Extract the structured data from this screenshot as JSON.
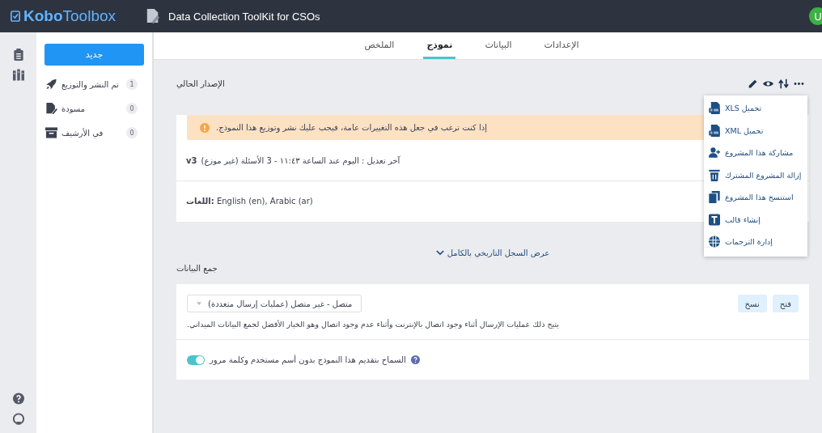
{
  "header": {
    "logo": "**Kobo**Toolbox",
    "project_title": "Data Collection ToolKit for CSOs",
    "avatar": "U"
  },
  "sidebar": {
    "new_button": "جديد",
    "items": [
      {
        "kind": "deployed",
        "label": "تم النشر والتوزيع",
        "count": "1"
      },
      {
        "kind": "draft",
        "label": "مسودة",
        "count": "0"
      },
      {
        "kind": "archived",
        "label": "في الأرشيف",
        "count": "0"
      }
    ]
  },
  "tabs": [
    {
      "label": "الإعدادات",
      "selected": false
    },
    {
      "label": "البيانات",
      "selected": false
    },
    {
      "label": "نموذج",
      "selected": true
    },
    {
      "label": "الملخص",
      "selected": false
    }
  ],
  "current_version": {
    "heading": "الإصدار الحالي",
    "alert": "إذا كنت ترغب في جعل هذه التغييرات عامة، فيجب عليك نشر وتوزيع هذا النموذج.",
    "version": "v3",
    "modified": "آخر تعديل : اليوم عند الساعة ١١:٤٣ - 3 الأسئلة  (غير موزع)",
    "languages": "**اللغات:** English (en), Arabic (ar)"
  },
  "actions_menu": {
    "items": [
      {
        "kind": "xls",
        "label": "تحميل XLS"
      },
      {
        "kind": "xml",
        "label": "تحميل XML"
      },
      {
        "kind": "share",
        "label": "مشاركة هذا المشروع"
      },
      {
        "kind": "remove",
        "label": "إزالة المشروع المشترك"
      },
      {
        "kind": "clone",
        "label": "استنسخ هذا المشروع"
      },
      {
        "kind": "template",
        "label": "إنشاء قالب"
      },
      {
        "kind": "translations",
        "label": "إدارة الترجمات"
      }
    ]
  },
  "history_link": "عرض السجل التاريخي بالكامل",
  "data_collection": {
    "heading": "جمع البيانات",
    "mode_select": "متصل - غير متصل (عمليات إرسال متعددة)",
    "buttons": [
      "فتح",
      "نسخ"
    ],
    "description": "يتيح ذلك عمليات الإرسال أثناء وجود اتصال بالإنترنت وأثناء عدم وجود اتصال وهو الخيار الأفضل لجمع البيانات الميداني.",
    "anonymous_toggle": {
      "label": "السماح بتقديم هذا النموذج بدون أسم مستخدم وكلمة مرور",
      "on": true
    }
  }
}
